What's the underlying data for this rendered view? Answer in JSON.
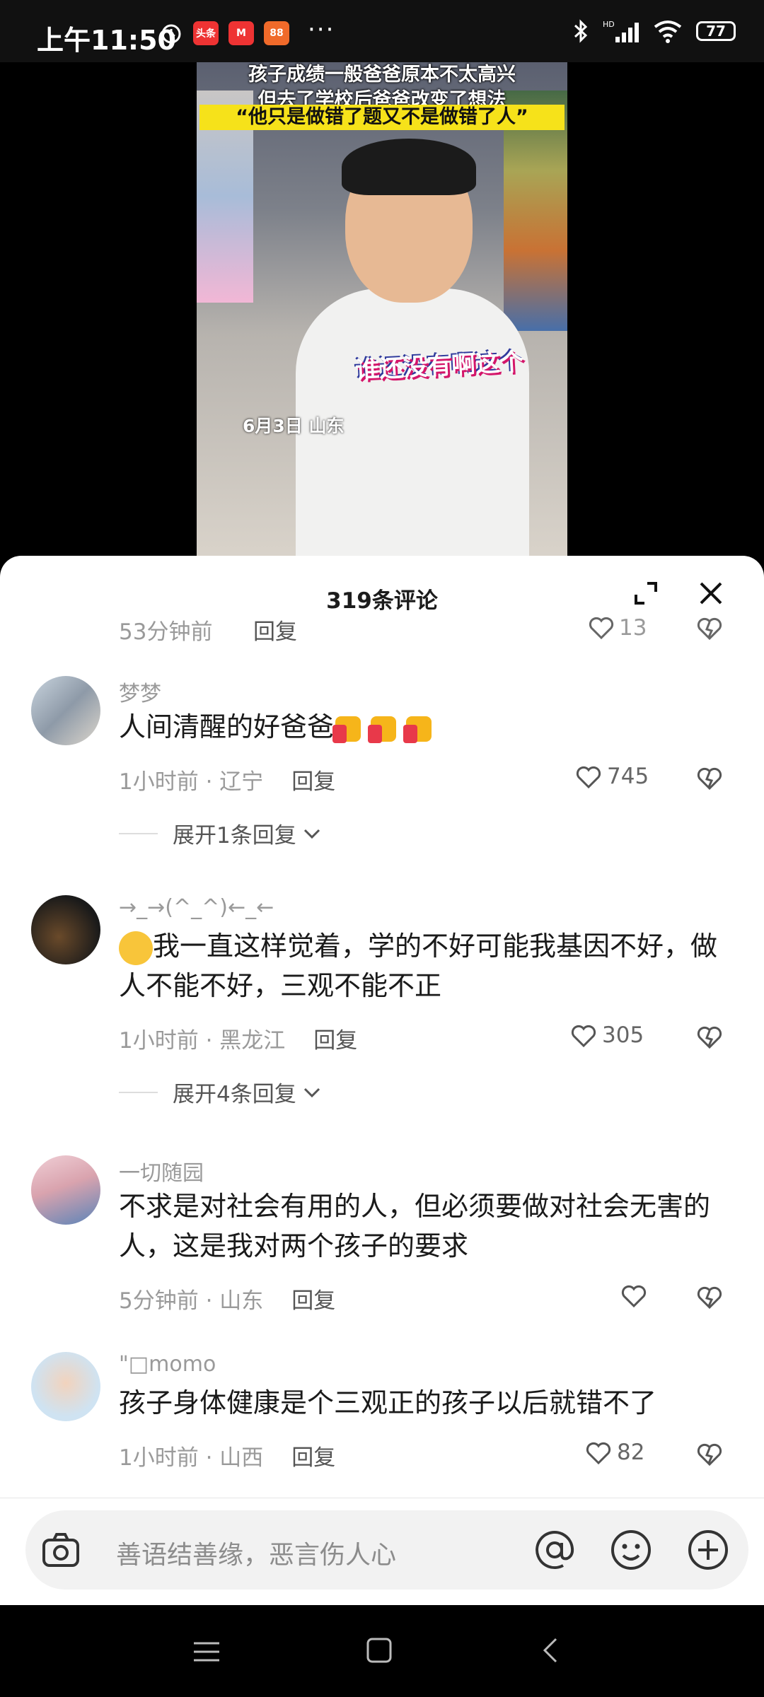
{
  "status_bar": {
    "time": "上午11:50",
    "apps": [
      "头条",
      "M",
      "88"
    ],
    "more": "···",
    "battery": "77"
  },
  "video": {
    "caption_top_line1": "孩子成绩一般爸爸原本不太高兴",
    "caption_top_line2": "但去了学校后爸爸改变了想法",
    "caption_highlight": "“他只是做错了题又不是做错了人”",
    "sticker": "谁还没有啊这个",
    "date_location": "6月3日 山东"
  },
  "sheet": {
    "title": "319条评论"
  },
  "previous_comment": {
    "time": "53分钟前",
    "reply": "回复",
    "likes": "13"
  },
  "comments": [
    {
      "user": "梦梦",
      "text": "人间清醒的好爸爸",
      "time": "1小时前",
      "location": "辽宁",
      "reply": "回复",
      "likes": "745",
      "expand": "展开1条回复"
    },
    {
      "user": "→_→(^_^)←_←",
      "text": "我一直这样觉着，学的不好可能我基因不好，做人不能不好，三观不能不正",
      "time": "1小时前",
      "location": "黑龙江",
      "reply": "回复",
      "likes": "305",
      "expand": "展开4条回复"
    },
    {
      "user": "一切随园",
      "text": "不求是对社会有用的人，但必须要做对社会无害的人，这是我对两个孩子的要求",
      "time": "5分钟前",
      "location": "山东",
      "reply": "回复",
      "likes": ""
    },
    {
      "user": "\"□momo",
      "text": "孩子身体健康是个三观正的孩子以后就错不了",
      "time": "1小时前",
      "location": "山西",
      "reply": "回复",
      "likes": "82"
    }
  ],
  "input": {
    "placeholder": "善语结善缘，恶言伤人心"
  },
  "icons": {
    "status": [
      "alarm-icon",
      "bluetooth-icon",
      "signal-icon",
      "wifi-icon",
      "battery-icon"
    ],
    "sheet": [
      "expand-icon",
      "close-icon"
    ],
    "comment": [
      "heart-icon",
      "dislike-icon",
      "chevron-down-icon"
    ],
    "input": [
      "camera-icon",
      "at-icon",
      "emoji-icon",
      "plus-icon"
    ],
    "nav": [
      "menu-icon",
      "home-icon",
      "back-icon"
    ]
  }
}
